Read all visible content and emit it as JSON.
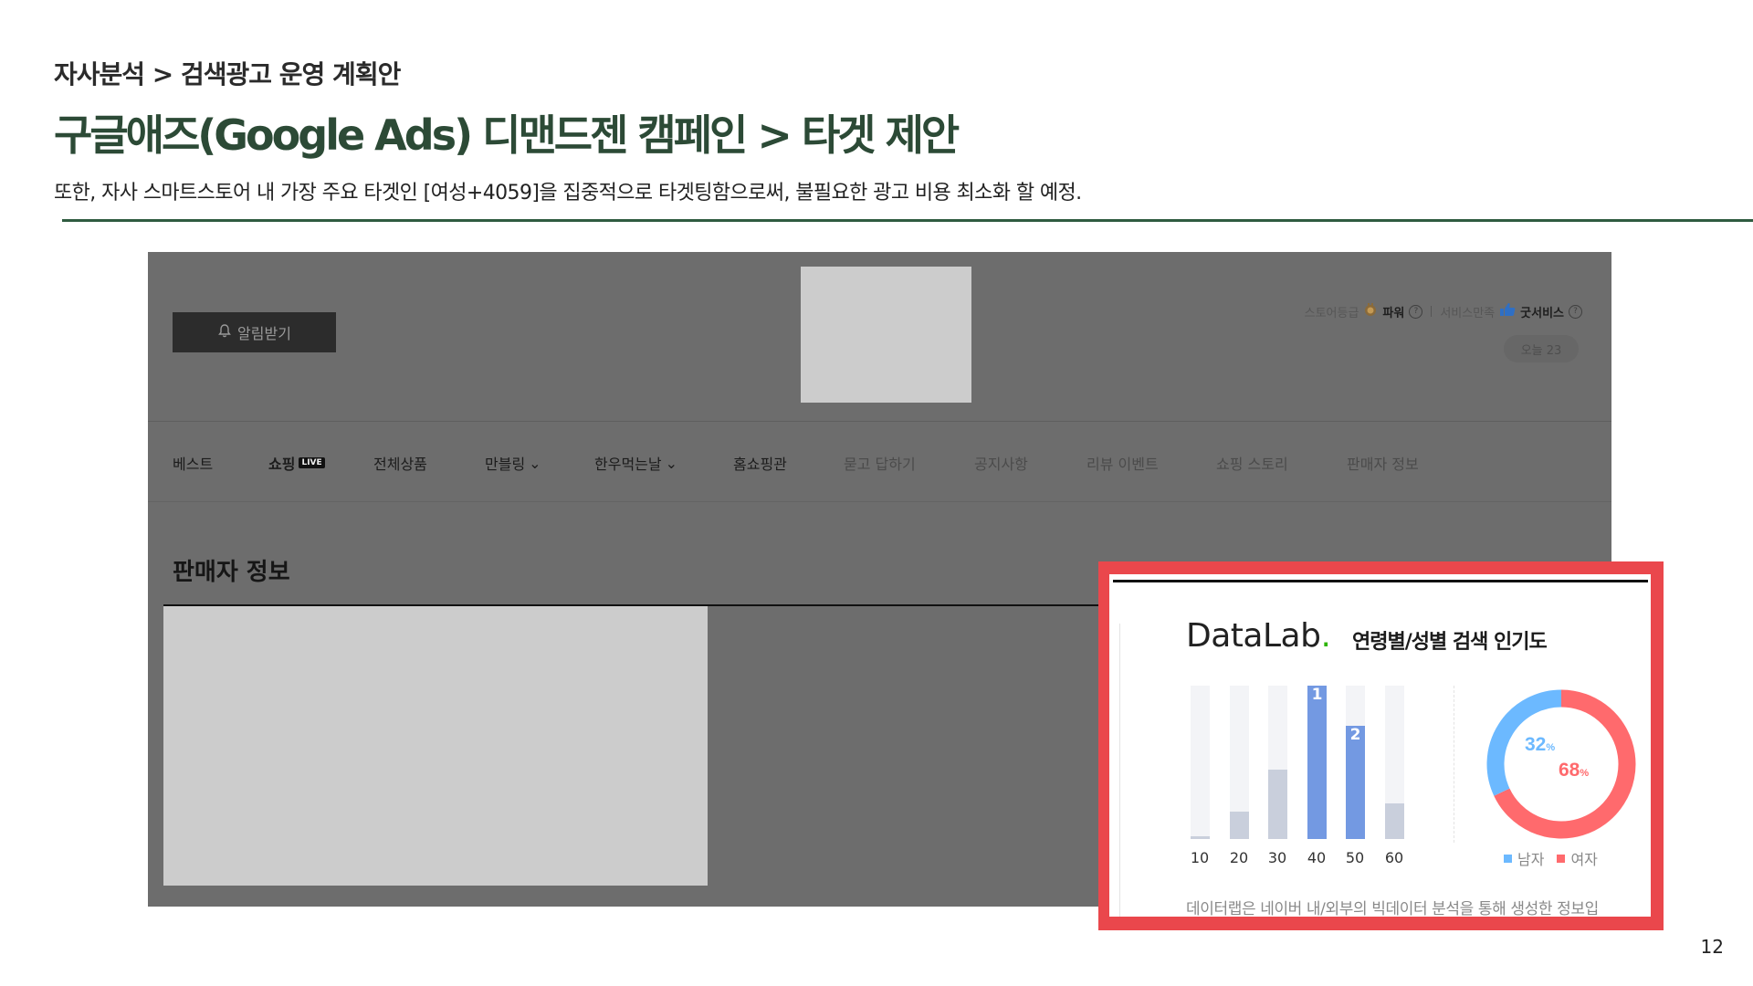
{
  "breadcrumb": "자사분석 > 검색광고 운영 계획안",
  "title": "구글애즈(Google Ads) 디맨드젠 캠페인 > 타겟 제안",
  "subtitle": "또한, 자사 스마트스토어 내 가장 주요 타겟인 [여성+4059]을 집중적으로 타겟팅함으로써, 불필요한 광고 비용 최소화 할 예정.",
  "colors": {
    "accent_title": "#2c4a36",
    "rule": "#2f5b40",
    "highlight_frame": "#ea474c",
    "bar_highlight": "#7399e2",
    "female": "#ff6a6d",
    "male": "#6cb9ff"
  },
  "store": {
    "notify_button": "알림받기",
    "notify_icon": "bell-icon",
    "grade_label": "스토어등급",
    "grade_value": "파워",
    "grade_icon": "badge-icon",
    "service_label": "서비스만족",
    "service_value": "굿서비스",
    "service_icon": "thumbs-up-icon",
    "help_mark": "?",
    "today": "오늘 23"
  },
  "nav": {
    "items": [
      {
        "label": "베스트"
      },
      {
        "label": "쇼핑",
        "badge": "LIVE"
      },
      {
        "label": "전체상품"
      },
      {
        "label": "만블링",
        "dropdown": "⌄"
      },
      {
        "label": "한우먹는날",
        "dropdown": "⌄"
      },
      {
        "label": "홈쇼핑관"
      },
      {
        "label": "묻고 답하기"
      },
      {
        "label": "공지사항"
      },
      {
        "label": "리뷰 이벤트"
      },
      {
        "label": "쇼핑 스토리"
      },
      {
        "label": "판매자 정보"
      }
    ]
  },
  "section_title": "판매자 정보",
  "datalab": {
    "logo": "DataLab",
    "logo_dot": ".",
    "title": "연령별/성별 검색 인기도",
    "footnote": "데이터랩은 네이버 내/외부의 빅데이터 분석을 통해 생성한 정보입"
  },
  "chart_data": [
    {
      "type": "bar",
      "title": "",
      "categories": [
        "10",
        "20",
        "30",
        "40",
        "50",
        "60"
      ],
      "values": [
        2,
        18,
        45,
        100,
        74,
        23
      ],
      "ranks": [
        "",
        "",
        "",
        "1",
        "2",
        ""
      ],
      "highlight": [
        false,
        false,
        false,
        true,
        true,
        false
      ],
      "ylim": [
        0,
        100
      ]
    },
    {
      "type": "pie",
      "title": "",
      "labels": [
        "남자",
        "여자"
      ],
      "values": [
        32,
        68
      ],
      "value_labels": [
        "32",
        "68"
      ],
      "unit": "%",
      "colors": [
        "#6cb9ff",
        "#ff6a6d"
      ]
    }
  ],
  "page_number": "12"
}
